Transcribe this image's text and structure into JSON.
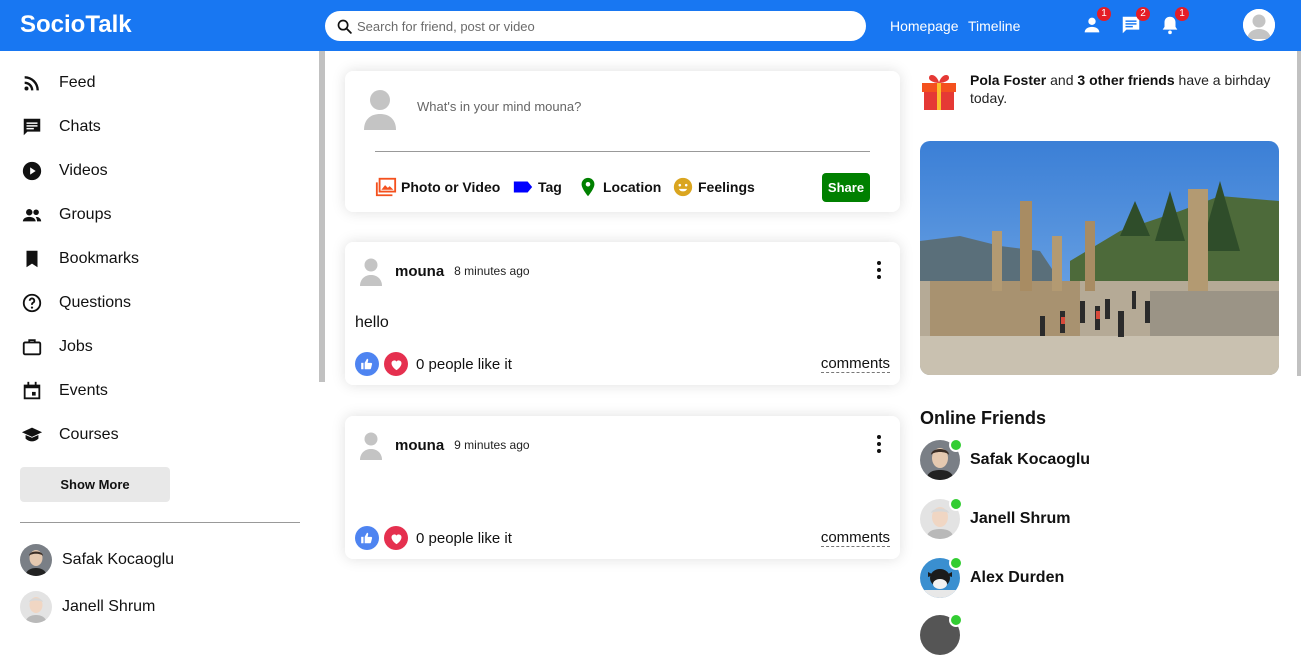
{
  "brand": {
    "name": "SocioTalk",
    "color": "#1877f2"
  },
  "search": {
    "placeholder": "Search for friend, post or video"
  },
  "nav": {
    "homepage": "Homepage",
    "timeline": "Timeline"
  },
  "notifications": {
    "friend_requests": "1",
    "messages": "2",
    "alerts": "1"
  },
  "sidebar": {
    "items": [
      {
        "label": "Feed",
        "icon": "rss-feed-icon"
      },
      {
        "label": "Chats",
        "icon": "chat-icon"
      },
      {
        "label": "Videos",
        "icon": "play-circle-icon"
      },
      {
        "label": "Groups",
        "icon": "group-icon"
      },
      {
        "label": "Bookmarks",
        "icon": "bookmark-icon"
      },
      {
        "label": "Questions",
        "icon": "help-circle-icon"
      },
      {
        "label": "Jobs",
        "icon": "briefcase-icon"
      },
      {
        "label": "Events",
        "icon": "calendar-icon"
      },
      {
        "label": "Courses",
        "icon": "graduation-cap-icon"
      }
    ],
    "show_more": "Show More",
    "friends": [
      "Safak Kocaoglu",
      "Janell Shrum"
    ]
  },
  "share": {
    "placeholder": "What's in your mind mouna?",
    "options": [
      "Photo or Video",
      "Tag",
      "Location",
      "Feelings"
    ],
    "button": "Share"
  },
  "posts": [
    {
      "user": "mouna",
      "time": "8 minutes ago",
      "text": "hello",
      "likes": "0 people like it",
      "comments": "comments"
    },
    {
      "user": "mouna",
      "time": "9 minutes ago",
      "text": "",
      "likes": "0 people like it",
      "comments": "comments"
    }
  ],
  "birthday": {
    "name": "Pola Foster",
    "connector": " and ",
    "others": "3 other friends",
    "rest": " have a birhday today."
  },
  "online": {
    "title": "Online Friends",
    "friends": [
      "Safak Kocaoglu",
      "Janell Shrum",
      "Alex Durden"
    ]
  },
  "colors": {
    "share_button": "#008000",
    "online_dot": "#32cd32",
    "badge": "#e41e26"
  }
}
